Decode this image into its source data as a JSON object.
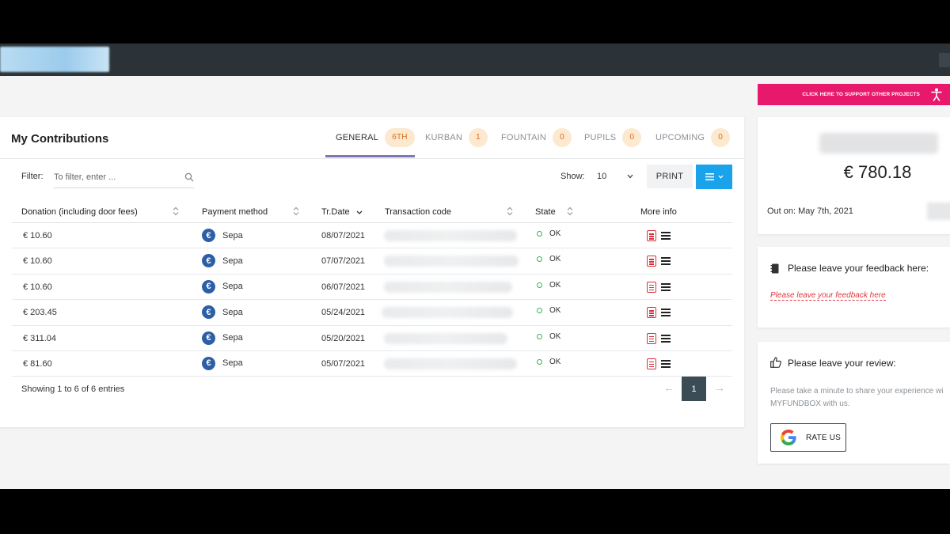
{
  "main": {
    "title": "My Contributions",
    "tabs": [
      {
        "label": "GENERAL",
        "badge": "6TH",
        "active": true
      },
      {
        "label": "KURBAN",
        "badge": "1",
        "active": false
      },
      {
        "label": "FOUNTAIN",
        "badge": "0",
        "active": false
      },
      {
        "label": "PUPILS",
        "badge": "0",
        "active": false
      },
      {
        "label": "UPCOMING",
        "badge": "0",
        "active": false
      }
    ],
    "filter_label": "Filter:",
    "filter_placeholder": "To filter, enter ...",
    "show_label": "Show:",
    "show_value": "10",
    "print_label": "PRINT",
    "table": {
      "columns": [
        "Donation (including door fees)",
        "Payment method",
        "Tr.Date",
        "Transaction code",
        "State",
        "More info"
      ],
      "rows": [
        {
          "amount": "€ 10.60",
          "method": "Sepa",
          "date": "08/07/2021",
          "state": "OK"
        },
        {
          "amount": "€ 10.60",
          "method": "Sepa",
          "date": "07/07/2021",
          "state": "OK"
        },
        {
          "amount": "€ 10.60",
          "method": "Sepa",
          "date": "06/07/2021",
          "state": "OK"
        },
        {
          "amount": "€ 203.45",
          "method": "Sepa",
          "date": "05/24/2021",
          "state": "OK"
        },
        {
          "amount": "€ 311.04",
          "method": "Sepa",
          "date": "05/20/2021",
          "state": "OK"
        },
        {
          "amount": "€ 81.60",
          "method": "Sepa",
          "date": "05/07/2021",
          "state": "OK"
        }
      ]
    },
    "showing": "Showing 1 to 6 of 6 entries",
    "pagination": {
      "prev": "←",
      "page": "1",
      "next": "→"
    }
  },
  "side": {
    "support_label": "CLICK HERE TO SUPPORT OTHER PROJECTS",
    "total_amount": "€ 780.18",
    "out_on": "Out on: May 7th, 2021",
    "feedback_title": "Please leave your feedback here:",
    "feedback_link": "Please leave your feedback here",
    "review_title": "Please leave your review:",
    "review_text": "Please take a minute to share your experience wi MYFUNDBOX with us.",
    "rate_label": "RATE US"
  },
  "colors": {
    "topbar": "#2b3339",
    "accent_pink": "#e8196c",
    "accent_blue": "#1aa3ea",
    "badge_bg": "#fde8d0",
    "badge_text": "#d8711d",
    "ok_green": "#3aae5a",
    "link_red": "#e0383e"
  },
  "icons": [
    "search-icon",
    "chevron-down-icon",
    "menu-icon",
    "euro-icon",
    "pdf-document-icon",
    "list-icon",
    "person-icon",
    "notebook-icon",
    "thumbs-up-icon",
    "google-icon",
    "arrow-left-icon",
    "arrow-right-icon"
  ]
}
